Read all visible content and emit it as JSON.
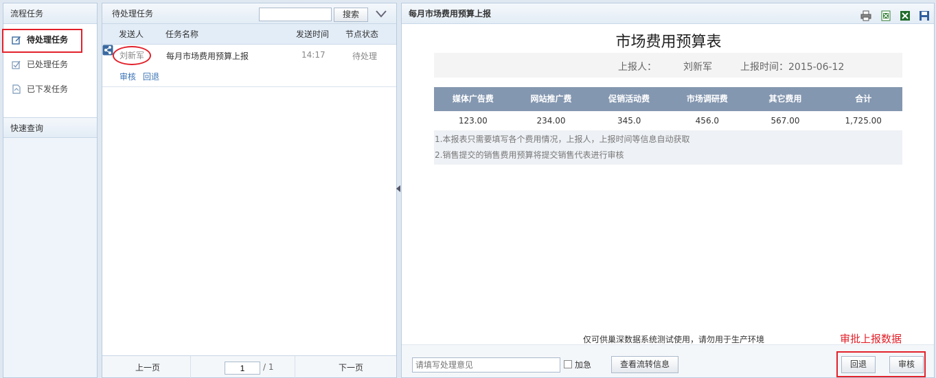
{
  "left": {
    "title": "流程任务",
    "items": [
      {
        "label": "待处理任务",
        "active": true,
        "icon": "edit-icon"
      },
      {
        "label": "已处理任务",
        "active": false,
        "icon": "checked-edit-icon"
      },
      {
        "label": "已下发任务",
        "active": false,
        "icon": "send-doc-icon"
      }
    ],
    "quick_query": "快速查询"
  },
  "middle": {
    "title": "待处理任务",
    "search_value": "",
    "search_button": "搜索",
    "columns": [
      "发送人",
      "任务名称",
      "发送时间",
      "节点状态"
    ],
    "rows": [
      {
        "sender": "刘新军",
        "task": "每月市场费用预算上报",
        "time": "14:17",
        "state": "待处理",
        "actions": [
          "审核",
          "回退"
        ]
      }
    ],
    "pager": {
      "prev": "上一页",
      "page": "1",
      "total": "/ 1",
      "next": "下一页"
    }
  },
  "right": {
    "title": "每月市场费用预算上报",
    "toolbar_icons": [
      "print-icon",
      "excel-icon",
      "excel-export-icon",
      "save-icon"
    ],
    "report_title": "市场费用预算表",
    "reporter_label": "上报人：",
    "reporter": "刘新军",
    "report_time": "上报时间：2015-06-12",
    "table": {
      "headers": [
        "媒体广告费",
        "网站推广费",
        "促销活动费",
        "市场调研费",
        "其它费用",
        "合计"
      ],
      "values": [
        "123.00",
        "234.00",
        "345.0",
        "456.0",
        "567.00",
        "1,725.00"
      ]
    },
    "notes": [
      "1.本报表只需要填写各个费用情况，上报人，上报时间等信息自动获取",
      "2.销售提交的销售费用预算将提交销售代表进行审核"
    ],
    "disclaimer": "仅可供巢深数据系统测试使用，请勿用于生产环境",
    "annotation": "审批上报数据",
    "footer": {
      "opinion_placeholder": "请填写处理意见",
      "urgent_label": "加急",
      "flow_button": "查看流转信息",
      "back_button": "回退",
      "audit_button": "审核"
    }
  },
  "colors": {
    "accent_red": "#e2202a",
    "table_header": "#8497b0",
    "link_blue": "#3a73b5"
  }
}
